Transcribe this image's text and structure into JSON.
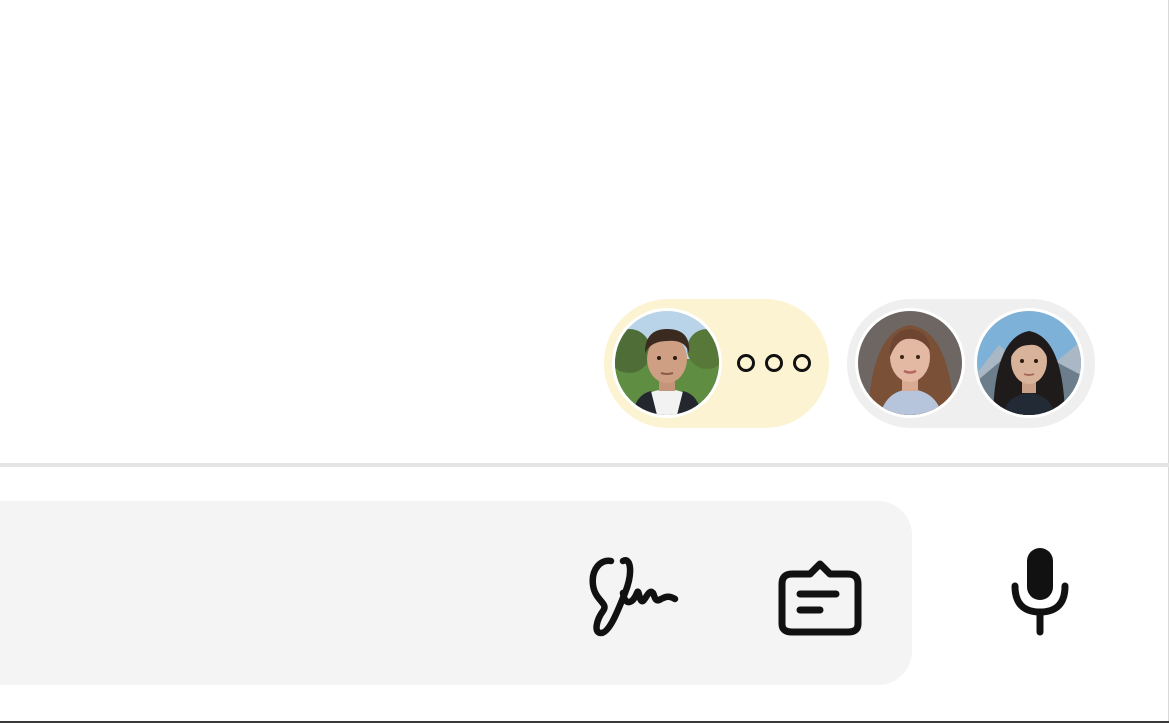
{
  "conversation": {
    "typing_participant": {
      "avatar_icon": "person-avatar-icon",
      "status_icon": "typing-dots-icon",
      "pill_color": "#fcf3d2"
    },
    "group_participants": {
      "avatars": [
        "person-avatar-icon",
        "person-avatar-icon"
      ],
      "pill_color": "#efefef"
    }
  },
  "composer": {
    "background": "#f4f4f4",
    "tools": [
      {
        "icon": "signature-icon"
      },
      {
        "icon": "chat-summary-icon"
      },
      {
        "icon": "microphone-icon"
      }
    ]
  }
}
